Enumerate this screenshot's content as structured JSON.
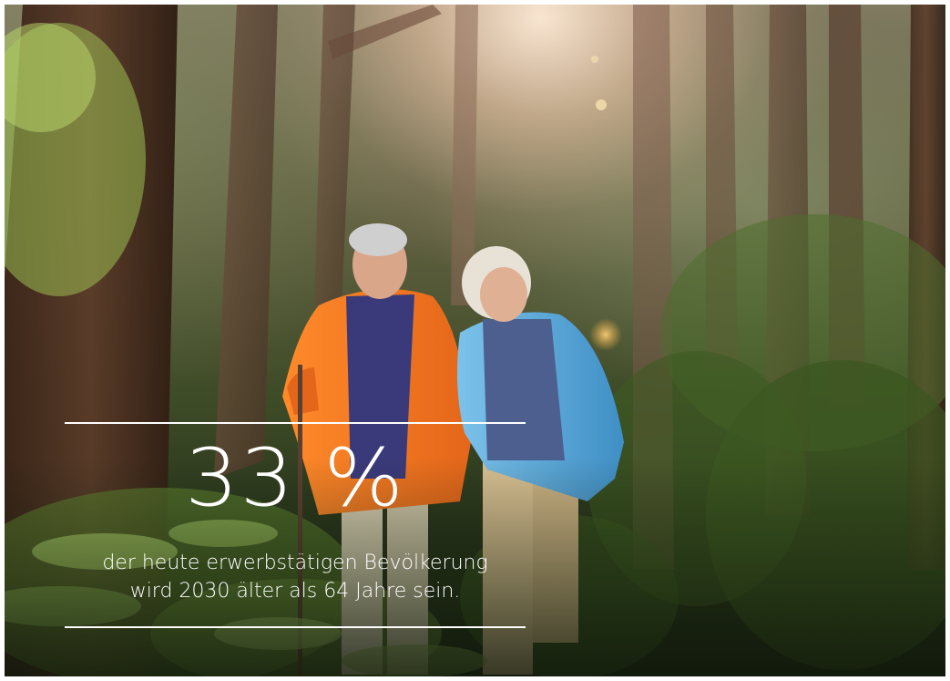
{
  "stat": {
    "value": "33 %",
    "caption_line1": "der heute erwerbstätigen Bevölkerung",
    "caption_line2": "wird 2030 älter als 64 Jahre sein."
  },
  "colors": {
    "text": "#ffffff",
    "rule": "#ffffff",
    "jacket_man": "#f07a1e",
    "jacket_woman": "#5aa9d8"
  }
}
